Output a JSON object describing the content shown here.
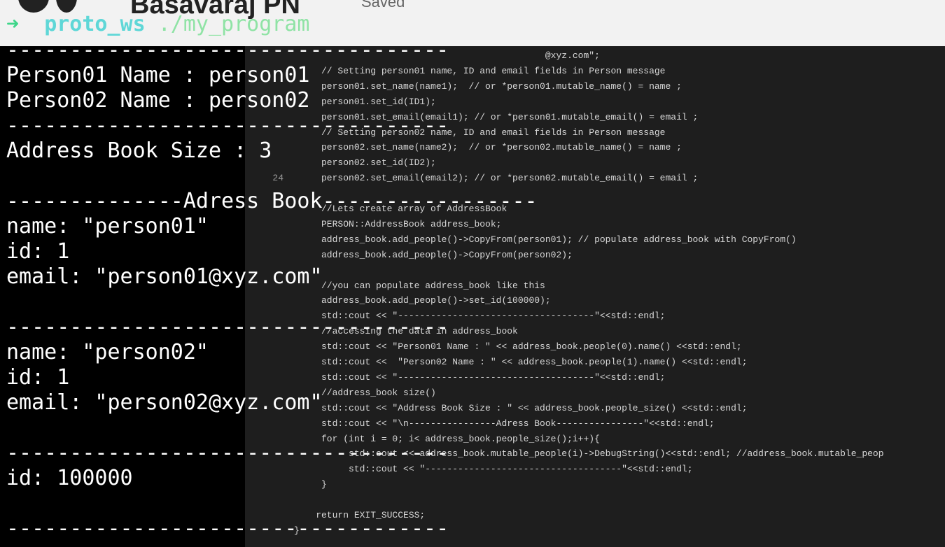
{
  "editor": {
    "author": "Basavaraj PN",
    "save_status": "Saved",
    "code_lines": [
      {
        "num": "",
        "text": "                                              @xyz.com\";"
      },
      {
        "num": "",
        "text": "     // Setting person01 name, ID and email fields in Person message"
      },
      {
        "num": "",
        "text": "     person01.set_name(name1);  // or *person01.mutable_name() = name ;"
      },
      {
        "num": "",
        "text": "     person01.set_id(ID1);"
      },
      {
        "num": "",
        "text": "     person01.set_email(email1); // or *person01.mutable_email() = email ;"
      },
      {
        "num": "",
        "text": "     // Setting person02 name, ID and email fields in Person message"
      },
      {
        "num": "",
        "text": "     person02.set_name(name2);  // or *person02.mutable_name() = name ;"
      },
      {
        "num": "",
        "text": "     person02.set_id(ID2);"
      },
      {
        "num": "24",
        "text": "     person02.set_email(email2); // or *person02.mutable_email() = email ;"
      },
      {
        "num": "",
        "text": ""
      },
      {
        "num": "",
        "text": "     //Lets create array of AddressBook"
      },
      {
        "num": "",
        "text": "     PERSON::AddressBook address_book;"
      },
      {
        "num": "",
        "text": "     address_book.add_people()->CopyFrom(person01); // populate address_book with CopyFrom()"
      },
      {
        "num": "",
        "text": "     address_book.add_people()->CopyFrom(person02);"
      },
      {
        "num": "",
        "text": ""
      },
      {
        "num": "",
        "text": "     //you can populate address_book like this"
      },
      {
        "num": "",
        "text": "     address_book.add_people()->set_id(100000);"
      },
      {
        "num": "",
        "text": "     std::cout << \"------------------------------------\"<<std::endl;"
      },
      {
        "num": "",
        "text": "     //accessing the data in address_book"
      },
      {
        "num": "",
        "text": "     std::cout << \"Person01 Name : \" << address_book.people(0).name() <<std::endl;"
      },
      {
        "num": "",
        "text": "     std::cout <<  \"Person02 Name : \" << address_book.people(1).name() <<std::endl;"
      },
      {
        "num": "",
        "text": "     std::cout << \"------------------------------------\"<<std::endl;"
      },
      {
        "num": "",
        "text": "     //address_book size()"
      },
      {
        "num": "",
        "text": "     std::cout << \"Address Book Size : \" << address_book.people_size() <<std::endl;"
      },
      {
        "num": "",
        "text": "     std::cout << \"\\n----------------Adress Book----------------\"<<std::endl;"
      },
      {
        "num": "",
        "text": "     for (int i = 0; i< address_book.people_size();i++){"
      },
      {
        "num": "",
        "text": "          std::cout << address_book.mutable_people(i)->DebugString()<<std::endl; //address_book.mutable_peop"
      },
      {
        "num": "",
        "text": "          std::cout << \"------------------------------------\"<<std::endl;"
      },
      {
        "num": "",
        "text": "     }"
      },
      {
        "num": "",
        "text": ""
      },
      {
        "num": "",
        "text": "    return EXIT_SUCCESS;"
      },
      {
        "num": "",
        "text": "}"
      }
    ]
  },
  "terminal": {
    "prompt_arrow": "➜",
    "prompt_dir": "proto_ws",
    "prompt_cmd": "./my_program",
    "rule": "-----------------------------------",
    "person01_name": "Person01 Name : person01",
    "person02_name": "Person02 Name : person02",
    "book_size": "Address Book Size : 3",
    "book_header": "--------------Adress Book-----------------",
    "entry1_name": "name: \"person01\"",
    "entry1_id": "id: 1",
    "entry1_email": "email: \"person01@xyz.com\"",
    "entry2_name": "name: \"person02\"",
    "entry2_id": "id: 1",
    "entry2_email": "email: \"person02@xyz.com\"",
    "entry3_id": "id: 100000"
  },
  "colors": {
    "background": "#000000",
    "text": "#ffffff",
    "prompt_arrow": "#3fd68a",
    "prompt_dir": "#5fd7d7",
    "prompt_cmd": "#8fe3a5",
    "editor_bg": "#1e1e1e"
  }
}
